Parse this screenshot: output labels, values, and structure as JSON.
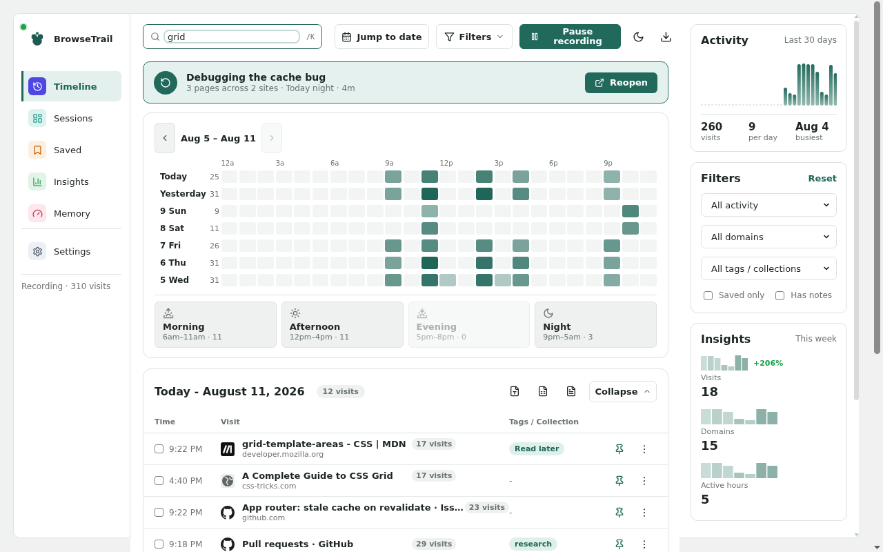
{
  "sidebar": {
    "app_name": "BrowseTrail",
    "nav": [
      {
        "label": "Timeline",
        "selected": true
      },
      {
        "label": "Sessions",
        "selected": false
      },
      {
        "label": "Saved",
        "selected": false
      },
      {
        "label": "Insights",
        "selected": false
      },
      {
        "label": "Memory",
        "selected": false
      }
    ],
    "secondary_nav": [
      {
        "label": "Settings",
        "selected": false
      }
    ],
    "status": "Recording · 310 visits"
  },
  "toolbar": {
    "search": {
      "value": "grid",
      "shortcut": "/K"
    },
    "jump_button": "Jump to date",
    "filters_button": "Filters",
    "pause_button": "Pause recording"
  },
  "banner": {
    "title": "Debugging the cache bug",
    "subtitle": "3 pages across 2 sites · Today night · 4m",
    "button": "Reopen"
  },
  "heatmap": {
    "range": "Aug 5 – Aug 11",
    "prev_disabled": false,
    "next_disabled": true,
    "hour_labels": [
      "12a",
      "3a",
      "6a",
      "9a",
      "12p",
      "3p",
      "6p",
      "9p"
    ],
    "rows": [
      {
        "day": "Today",
        "count": "25",
        "hours": [
          {
            "color": "#f3f5f4"
          },
          {
            "color": "#f3f5f4"
          },
          {
            "color": "#f3f5f4"
          },
          {
            "color": "#f3f5f4"
          },
          {
            "color": "#f3f5f4"
          },
          {
            "color": "#f3f5f4"
          },
          {
            "color": "#f3f5f4"
          },
          {
            "color": "#f3f5f4"
          },
          {
            "color": "#f3f5f4"
          },
          {
            "color": "#79a39b"
          },
          {
            "color": "#f3f5f4"
          },
          {
            "color": "#478276"
          },
          {
            "color": "#f3f5f4"
          },
          {
            "color": "#f3f5f4"
          },
          {
            "color": "#478276"
          },
          {
            "color": "#f3f5f4"
          },
          {
            "color": "#79a39b"
          },
          {
            "color": "#f3f5f4"
          },
          {
            "color": "#f3f5f4"
          },
          {
            "color": "#f3f5f4"
          },
          {
            "color": "#f3f5f4"
          },
          {
            "color": "#8fb3ac"
          },
          {
            "color": "#f3f5f4"
          },
          {
            "color": "#f3f5f4"
          }
        ]
      },
      {
        "day": "Yesterday",
        "count": "31",
        "hours": [
          {
            "color": "#f3f5f4"
          },
          {
            "color": "#f3f5f4"
          },
          {
            "color": "#f3f5f4"
          },
          {
            "color": "#f3f5f4"
          },
          {
            "color": "#f3f5f4"
          },
          {
            "color": "#f3f5f4"
          },
          {
            "color": "#f3f5f4"
          },
          {
            "color": "#f3f5f4"
          },
          {
            "color": "#f3f5f4"
          },
          {
            "color": "#79a39b"
          },
          {
            "color": "#f3f5f4"
          },
          {
            "color": "#1f6658"
          },
          {
            "color": "#f3f5f4"
          },
          {
            "color": "#f3f5f4"
          },
          {
            "color": "#1f6658"
          },
          {
            "color": "#f3f5f4"
          },
          {
            "color": "#578c82"
          },
          {
            "color": "#f3f5f4"
          },
          {
            "color": "#f3f5f4"
          },
          {
            "color": "#f3f5f4"
          },
          {
            "color": "#f3f5f4"
          },
          {
            "color": "#8fb3ac"
          },
          {
            "color": "#f3f5f4"
          },
          {
            "color": "#f3f5f4"
          }
        ]
      },
      {
        "day": "9 Sun",
        "count": "9",
        "hours": [
          {
            "color": "#f3f5f4"
          },
          {
            "color": "#f3f5f4"
          },
          {
            "color": "#f3f5f4"
          },
          {
            "color": "#f3f5f4"
          },
          {
            "color": "#f3f5f4"
          },
          {
            "color": "#f3f5f4"
          },
          {
            "color": "#f3f5f4"
          },
          {
            "color": "#f3f5f4"
          },
          {
            "color": "#f3f5f4"
          },
          {
            "color": "#f3f5f4"
          },
          {
            "color": "#f3f5f4"
          },
          {
            "color": "#8fb3ac"
          },
          {
            "color": "#f3f5f4"
          },
          {
            "color": "#f3f5f4"
          },
          {
            "color": "#f3f5f4"
          },
          {
            "color": "#f3f5f4"
          },
          {
            "color": "#f3f5f4"
          },
          {
            "color": "#f3f5f4"
          },
          {
            "color": "#f3f5f4"
          },
          {
            "color": "#f3f5f4"
          },
          {
            "color": "#f3f5f4"
          },
          {
            "color": "#f3f5f4"
          },
          {
            "color": "#50887d"
          },
          {
            "color": "#f3f5f4"
          }
        ]
      },
      {
        "day": "8 Sat",
        "count": "11",
        "hours": [
          {
            "color": "#f3f5f4"
          },
          {
            "color": "#f3f5f4"
          },
          {
            "color": "#f3f5f4"
          },
          {
            "color": "#f3f5f4"
          },
          {
            "color": "#f3f5f4"
          },
          {
            "color": "#f3f5f4"
          },
          {
            "color": "#f3f5f4"
          },
          {
            "color": "#f3f5f4"
          },
          {
            "color": "#f3f5f4"
          },
          {
            "color": "#f3f5f4"
          },
          {
            "color": "#f3f5f4"
          },
          {
            "color": "#578c82"
          },
          {
            "color": "#f3f5f4"
          },
          {
            "color": "#f3f5f4"
          },
          {
            "color": "#f3f5f4"
          },
          {
            "color": "#f3f5f4"
          },
          {
            "color": "#f3f5f4"
          },
          {
            "color": "#f3f5f4"
          },
          {
            "color": "#f3f5f4"
          },
          {
            "color": "#f3f5f4"
          },
          {
            "color": "#f3f5f4"
          },
          {
            "color": "#f3f5f4"
          },
          {
            "color": "#67978d"
          },
          {
            "color": "#f3f5f4"
          }
        ]
      },
      {
        "day": "7 Fri",
        "count": "26",
        "hours": [
          {
            "color": "#f3f5f4"
          },
          {
            "color": "#f3f5f4"
          },
          {
            "color": "#f3f5f4"
          },
          {
            "color": "#f3f5f4"
          },
          {
            "color": "#f3f5f4"
          },
          {
            "color": "#f3f5f4"
          },
          {
            "color": "#f3f5f4"
          },
          {
            "color": "#f3f5f4"
          },
          {
            "color": "#f3f5f4"
          },
          {
            "color": "#67978d"
          },
          {
            "color": "#f3f5f4"
          },
          {
            "color": "#578c82"
          },
          {
            "color": "#f3f5f4"
          },
          {
            "color": "#f3f5f4"
          },
          {
            "color": "#578c82"
          },
          {
            "color": "#f3f5f4"
          },
          {
            "color": "#79a39b"
          },
          {
            "color": "#f3f5f4"
          },
          {
            "color": "#f3f5f4"
          },
          {
            "color": "#f3f5f4"
          },
          {
            "color": "#f3f5f4"
          },
          {
            "color": "#67978d"
          },
          {
            "color": "#f3f5f4"
          },
          {
            "color": "#f3f5f4"
          }
        ]
      },
      {
        "day": "6 Thu",
        "count": "31",
        "hours": [
          {
            "color": "#f3f5f4"
          },
          {
            "color": "#f3f5f4"
          },
          {
            "color": "#f3f5f4"
          },
          {
            "color": "#f3f5f4"
          },
          {
            "color": "#f3f5f4"
          },
          {
            "color": "#f3f5f4"
          },
          {
            "color": "#f3f5f4"
          },
          {
            "color": "#f3f5f4"
          },
          {
            "color": "#f3f5f4"
          },
          {
            "color": "#79a39b"
          },
          {
            "color": "#f3f5f4"
          },
          {
            "color": "#1f6658"
          },
          {
            "color": "#f3f5f4"
          },
          {
            "color": "#f3f5f4"
          },
          {
            "color": "#357569"
          },
          {
            "color": "#f3f5f4"
          },
          {
            "color": "#50887d"
          },
          {
            "color": "#f3f5f4"
          },
          {
            "color": "#f3f5f4"
          },
          {
            "color": "#f3f5f4"
          },
          {
            "color": "#f3f5f4"
          },
          {
            "color": "#79a39b"
          },
          {
            "color": "#f3f5f4"
          },
          {
            "color": "#f3f5f4"
          }
        ]
      },
      {
        "day": "5 Wed",
        "count": "31",
        "hours": [
          {
            "color": "#f3f5f4"
          },
          {
            "color": "#f3f5f4"
          },
          {
            "color": "#f3f5f4"
          },
          {
            "color": "#f3f5f4"
          },
          {
            "color": "#f3f5f4"
          },
          {
            "color": "#f3f5f4"
          },
          {
            "color": "#f3f5f4"
          },
          {
            "color": "#f3f5f4"
          },
          {
            "color": "#f3f5f4"
          },
          {
            "color": "#67978d"
          },
          {
            "color": "#f3f5f4"
          },
          {
            "color": "#357569"
          },
          {
            "color": "#b1c9c5"
          },
          {
            "color": "#f3f5f4"
          },
          {
            "color": "#357569"
          },
          {
            "color": "#b1c9c5"
          },
          {
            "color": "#67978d"
          },
          {
            "color": "#f3f5f4"
          },
          {
            "color": "#f3f5f4"
          },
          {
            "color": "#f3f5f4"
          },
          {
            "color": "#f3f5f4"
          },
          {
            "color": "#84aba3"
          },
          {
            "color": "#f3f5f4"
          },
          {
            "color": "#f3f5f4"
          }
        ]
      }
    ],
    "periods": [
      {
        "label": "Morning",
        "detail": "6am–11am · 11",
        "disabled": false
      },
      {
        "label": "Afternoon",
        "detail": "12pm–4pm · 11",
        "disabled": false
      },
      {
        "label": "Evening",
        "detail": "5pm–8pm · 0",
        "disabled": true
      },
      {
        "label": "Night",
        "detail": "9pm–5am · 3",
        "disabled": false
      }
    ]
  },
  "day": {
    "title": "Today - August 11, 2026",
    "count": "12 visits",
    "collapse_button": "Collapse",
    "columns": [
      "Time",
      "Visit",
      "Tags / Collection"
    ],
    "rows": [
      {
        "checked": false,
        "time": "9:22 PM",
        "title": "grid-template-areas - CSS | MDN",
        "visits": "17 visits",
        "domain": "developer.mozilla.org",
        "tag": "Read later",
        "tagged": true
      },
      {
        "checked": false,
        "time": "4:40 PM",
        "title": "A Complete Guide to CSS Grid",
        "visits": "17 visits",
        "domain": "css-tricks.com",
        "tag": "-",
        "tagged": false
      },
      {
        "checked": false,
        "time": "9:22 PM",
        "title": "App router: stale cache on revalidate · Iss…",
        "visits": "23 visits",
        "domain": "github.com",
        "tag": "-",
        "tagged": false
      },
      {
        "checked": false,
        "time": "9:18 PM",
        "title": "Pull requests · GitHub",
        "visits": "29 visits",
        "tag": "research",
        "tagged": true
      }
    ]
  },
  "activity": {
    "title": "Activity",
    "period": "Last 30 days",
    "stats": [
      {
        "value": "260",
        "label": "visits"
      },
      {
        "value": "9",
        "label": "per day"
      },
      {
        "value": "Aug 4",
        "label": "busiest"
      }
    ]
  },
  "filters": {
    "title": "Filters",
    "reset": "Reset",
    "selects": [
      "All activity",
      "All domains",
      "All tags / collections"
    ],
    "checkboxes": [
      {
        "label": "Saved only",
        "checked": false
      },
      {
        "label": "Has notes",
        "checked": false
      }
    ]
  },
  "insights": {
    "title": "Insights",
    "period": "This week",
    "metrics": [
      {
        "label": "Visits",
        "value": "18",
        "change": "+206%"
      },
      {
        "label": "Domains",
        "value": "15"
      },
      {
        "label": "Active hours",
        "value": "5"
      }
    ]
  }
}
